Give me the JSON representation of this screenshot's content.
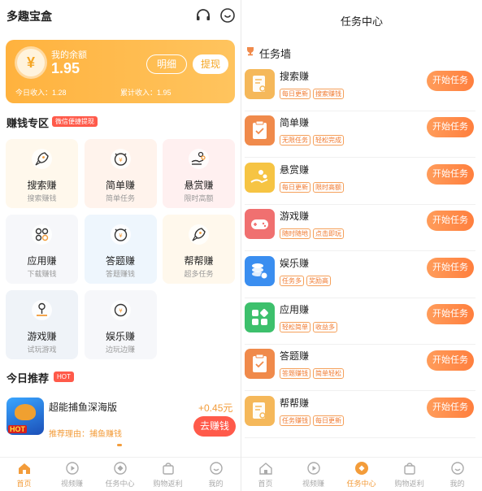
{
  "left": {
    "title": "多趣宝盒",
    "balance": {
      "label": "我的余额",
      "value": "1.95",
      "symbol": "¥",
      "detail_btn": "明细",
      "withdraw_btn": "提现",
      "today_income": "今日收入：1.28",
      "total_income": "累计收入：1.95"
    },
    "earn_section": {
      "title": "赚钱专区",
      "tag": "微信便捷提现"
    },
    "grid": [
      {
        "name": "搜索赚",
        "sub": "搜索赚钱",
        "bg": "#fff8ec",
        "icon": "rocket-icon"
      },
      {
        "name": "简单赚",
        "sub": "简单任务",
        "bg": "#fff3ec",
        "icon": "coin-clock-icon"
      },
      {
        "name": "悬赏赚",
        "sub": "限时高额",
        "bg": "#fff0f0",
        "icon": "hand-coins-icon"
      },
      {
        "name": "应用赚",
        "sub": "下载赚钱",
        "bg": "#f6f7fa",
        "icon": "apps-icon"
      },
      {
        "name": "答题赚",
        "sub": "答题赚钱",
        "bg": "#eef6fd",
        "icon": "coin-clock-icon"
      },
      {
        "name": "帮帮赚",
        "sub": "超多任务",
        "bg": "#fff8ec",
        "icon": "rocket-icon"
      },
      {
        "name": "游戏赚",
        "sub": "试玩游戏",
        "bg": "#eff3f8",
        "icon": "joystick-icon"
      },
      {
        "name": "娱乐赚",
        "sub": "边玩边赚",
        "bg": "#f6f7fa",
        "icon": "coin-cycle-icon"
      }
    ],
    "today": {
      "title": "今日推荐",
      "tag": "HOT"
    },
    "game": {
      "name": "超能捕鱼深海版",
      "reason": "推荐理由：捕鱼赚钱",
      "reward": "+0.45元",
      "button": "去赚钱",
      "badge": "HOT"
    },
    "tabs": [
      {
        "label": "首页",
        "icon": "home-icon",
        "active": true
      },
      {
        "label": "视频赚",
        "icon": "play-icon",
        "active": false
      },
      {
        "label": "任务中心",
        "icon": "task-icon",
        "active": false
      },
      {
        "label": "购物返利",
        "icon": "shopping-bag-icon",
        "active": false
      },
      {
        "label": "我的",
        "icon": "smile-icon",
        "active": false
      }
    ]
  },
  "right": {
    "title": "任务中心",
    "wall_title": "任务墙",
    "tasks": [
      {
        "name": "搜索赚",
        "tags": [
          "每日更新",
          "搜索赚钱"
        ],
        "button": "开始任务",
        "color": "#f5b85a",
        "icon": "search-doc-icon"
      },
      {
        "name": "简单赚",
        "tags": [
          "无限任务",
          "轻松完成"
        ],
        "button": "开始任务",
        "color": "#f08a4b",
        "icon": "clipboard-check-icon"
      },
      {
        "name": "悬赏赚",
        "tags": [
          "每日更新",
          "限时高额"
        ],
        "button": "开始任务",
        "color": "#f6c443",
        "icon": "hand-coins-icon"
      },
      {
        "name": "游戏赚",
        "tags": [
          "随时随地",
          "点击即玩"
        ],
        "button": "开始任务",
        "color": "#f07070",
        "icon": "gamepad-icon"
      },
      {
        "name": "娱乐赚",
        "tags": [
          "任务多",
          "奖励高"
        ],
        "button": "开始任务",
        "color": "#3a8ef0",
        "icon": "coin-stack-icon"
      },
      {
        "name": "应用赚",
        "tags": [
          "轻松简单",
          "收益多"
        ],
        "button": "开始任务",
        "color": "#3dc06c",
        "icon": "apps-icon"
      },
      {
        "name": "答题赚",
        "tags": [
          "答题赚钱",
          "简单轻松"
        ],
        "button": "开始任务",
        "color": "#f08a4b",
        "icon": "clipboard-check-icon"
      },
      {
        "name": "帮帮赚",
        "tags": [
          "任务赚钱",
          "每日更新"
        ],
        "button": "开始任务",
        "color": "#f5b85a",
        "icon": "search-doc-icon"
      }
    ],
    "tabs": [
      {
        "label": "首页",
        "icon": "home-icon",
        "active": false
      },
      {
        "label": "视频赚",
        "icon": "play-icon",
        "active": false
      },
      {
        "label": "任务中心",
        "icon": "task-icon",
        "active": true
      },
      {
        "label": "购物返利",
        "icon": "shopping-bag-icon",
        "active": false
      },
      {
        "label": "我的",
        "icon": "smile-icon",
        "active": false
      }
    ]
  },
  "colors": {
    "accent": "#f39c3a",
    "red": "#ff5a4a",
    "balance_card": "#ffb23e"
  }
}
